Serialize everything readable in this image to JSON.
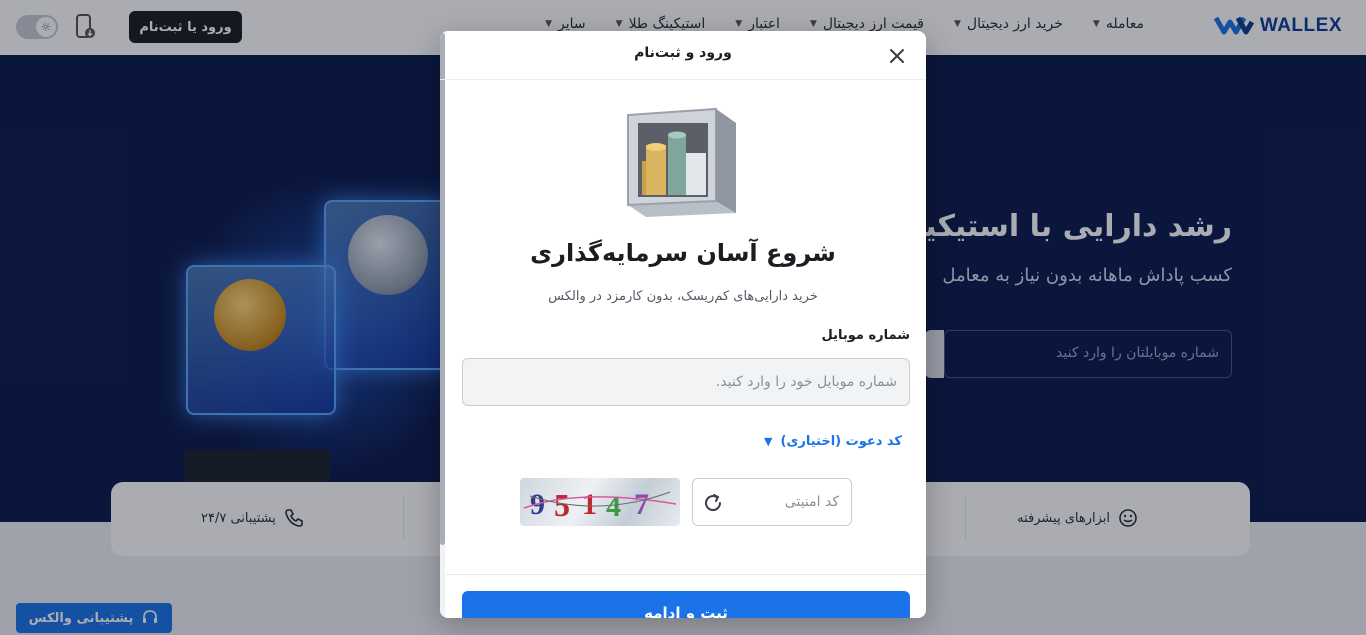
{
  "header": {
    "logo_text": "WALLEX",
    "nav": [
      {
        "label": "معامله"
      },
      {
        "label": "خرید ارز دیجیتال"
      },
      {
        "label": "قیمت ارز دیجیتال"
      },
      {
        "label": "اعتبار"
      },
      {
        "label": "استیکینگ طلا"
      },
      {
        "label": "سایر"
      }
    ],
    "login_label": "ورود یا ثبت‌نام"
  },
  "hero": {
    "title": "رشد دارایی با استیکینگ",
    "subtitle": "کسب پاداش ماهانه بدون نیاز به معامل",
    "input_placeholder": "شماره موبایلتان را وارد کنید"
  },
  "features": {
    "support_label": "پشتیبانی ۲۴/۷",
    "tools_label": "ابزارهای پیشرفته"
  },
  "support_chip": {
    "label": "پشتیبانی والکس"
  },
  "modal": {
    "title": "ورود و ثبت‌نام",
    "heading": "شروع آسان سرمایه‌گذاری",
    "subheading": "خرید دارایی‌های کم‌ریسک، بدون کارمزد در والکس",
    "phone_label": "شماره موبایل",
    "phone_placeholder": "شماره موبایل خود را وارد کنید.",
    "invite_label": "کد دعوت (اختیاری)",
    "captcha_placeholder": "کد امنیتی",
    "captcha_digits": "95147",
    "submit_label": "ثبت و ادامه"
  },
  "colors": {
    "accent": "#1a73e8",
    "hero_bg": "#0c1a4d",
    "dark_button": "#1b1d22"
  }
}
